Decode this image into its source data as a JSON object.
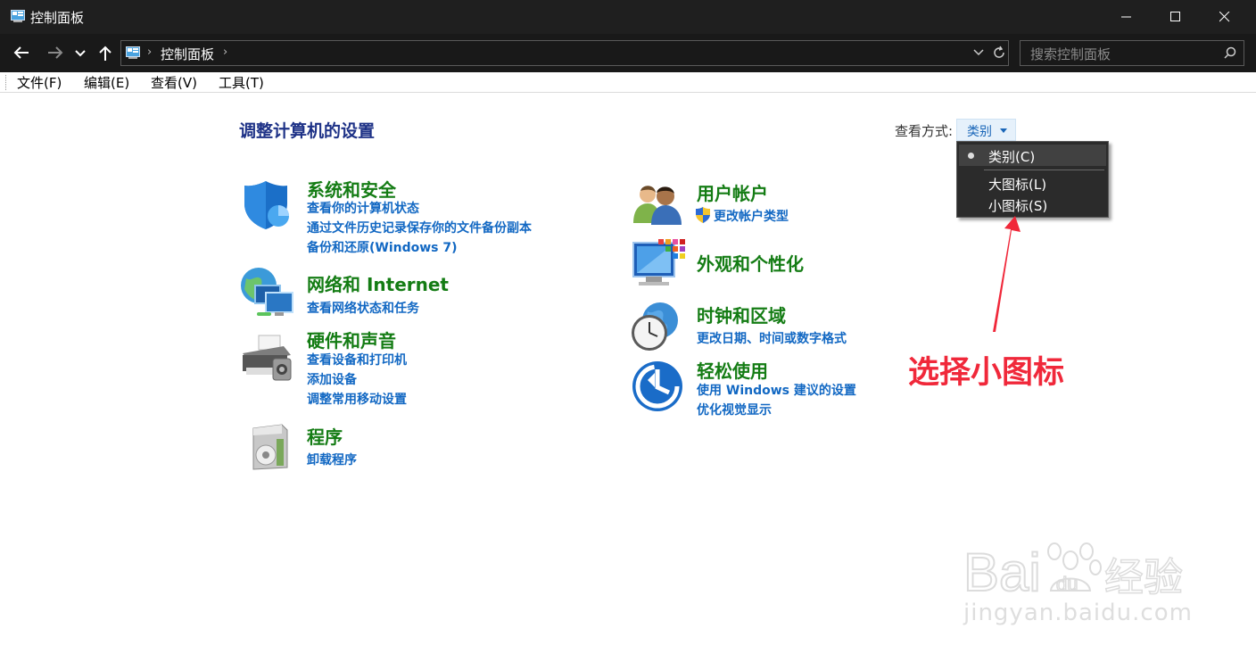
{
  "window": {
    "title": "控制面板",
    "minimize_icon": "minimize-icon",
    "maximize_icon": "maximize-icon",
    "close_icon": "close-icon"
  },
  "addressbar": {
    "breadcrumb": [
      "控制面板"
    ],
    "search_placeholder": "搜索控制面板"
  },
  "menubar": {
    "items": [
      "文件(F)",
      "编辑(E)",
      "查看(V)",
      "工具(T)"
    ]
  },
  "main": {
    "title": "调整计算机的设置",
    "view_by_label": "查看方式:",
    "view_by_value": "类别",
    "view_menu": {
      "options": [
        "类别(C)",
        "大图标(L)",
        "小图标(S)"
      ],
      "selected": "类别(C)"
    },
    "categories_left": [
      {
        "title": "系统和安全",
        "icon": "shield-icon",
        "links": [
          "查看你的计算机状态",
          "通过文件历史记录保存你的文件备份副本",
          "备份和还原(Windows 7)"
        ]
      },
      {
        "title": "网络和 Internet",
        "icon": "network-icon",
        "links": [
          "查看网络状态和任务"
        ]
      },
      {
        "title": "硬件和声音",
        "icon": "printer-icon",
        "links": [
          "查看设备和打印机",
          "添加设备",
          "调整常用移动设置"
        ]
      },
      {
        "title": "程序",
        "icon": "programs-icon",
        "links": [
          "卸载程序"
        ]
      }
    ],
    "categories_right": [
      {
        "title": "用户帐户",
        "icon": "users-icon",
        "links": [
          "更改帐户类型"
        ]
      },
      {
        "title": "外观和个性化",
        "icon": "appearance-icon",
        "links": []
      },
      {
        "title": "时钟和区域",
        "icon": "clock-icon",
        "links": [
          "更改日期、时间或数字格式"
        ]
      },
      {
        "title": "轻松使用",
        "icon": "ease-of-access-icon",
        "links": [
          "使用 Windows 建议的设置",
          "优化视觉显示"
        ]
      }
    ]
  },
  "annotation": {
    "text": "选择小图标",
    "color": "#f0283a"
  },
  "watermark": {
    "logo_text": "Bai du 经验",
    "url_text": "jingyan.baidu.com"
  },
  "colors": {
    "title_bar": "#1f1f1f",
    "category_title": "#147c14",
    "link": "#1268c3",
    "page_title": "#1e3287"
  }
}
